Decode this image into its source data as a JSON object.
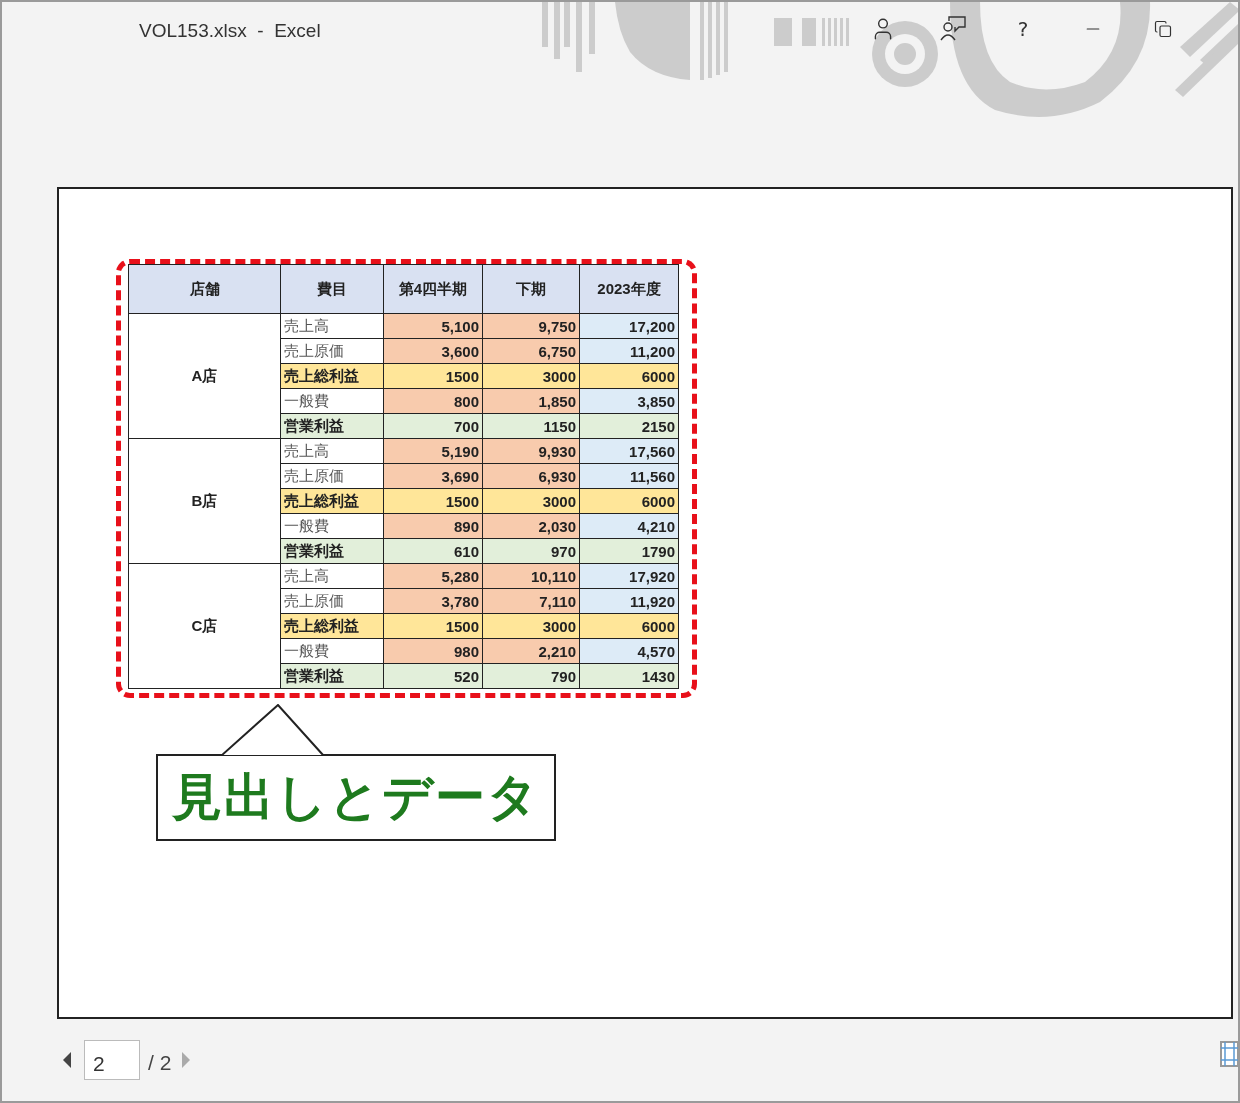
{
  "window": {
    "title": "VOL153.xlsx  -  Excel",
    "help": "?"
  },
  "table": {
    "columns": [
      "店舗",
      "費目",
      "第4四半期",
      "下期",
      "2023年度"
    ],
    "stores": [
      {
        "name": "A店",
        "rows": [
          {
            "kind": "sales",
            "item": "売上高",
            "values": [
              "5,100",
              "9,750",
              "17,200"
            ]
          },
          {
            "kind": "sales",
            "item": "売上原価",
            "values": [
              "3,600",
              "6,750",
              "11,200"
            ]
          },
          {
            "kind": "gross",
            "item": "売上総利益",
            "values": [
              "1500",
              "3000",
              "6000"
            ]
          },
          {
            "kind": "sales",
            "item": "一般費",
            "values": [
              "800",
              "1,850",
              "3,850"
            ]
          },
          {
            "kind": "operating",
            "item": "営業利益",
            "values": [
              "700",
              "1150",
              "2150"
            ]
          }
        ]
      },
      {
        "name": "B店",
        "rows": [
          {
            "kind": "sales",
            "item": "売上高",
            "values": [
              "5,190",
              "9,930",
              "17,560"
            ]
          },
          {
            "kind": "sales",
            "item": "売上原価",
            "values": [
              "3,690",
              "6,930",
              "11,560"
            ]
          },
          {
            "kind": "gross",
            "item": "売上総利益",
            "values": [
              "1500",
              "3000",
              "6000"
            ]
          },
          {
            "kind": "sales",
            "item": "一般費",
            "values": [
              "890",
              "2,030",
              "4,210"
            ]
          },
          {
            "kind": "operating",
            "item": "営業利益",
            "values": [
              "610",
              "970",
              "1790"
            ]
          }
        ]
      },
      {
        "name": "C店",
        "rows": [
          {
            "kind": "sales",
            "item": "売上高",
            "values": [
              "5,280",
              "10,110",
              "17,920"
            ]
          },
          {
            "kind": "sales",
            "item": "売上原価",
            "values": [
              "3,780",
              "7,110",
              "11,920"
            ]
          },
          {
            "kind": "gross",
            "item": "売上総利益",
            "values": [
              "1500",
              "3000",
              "6000"
            ]
          },
          {
            "kind": "sales",
            "item": "一般費",
            "values": [
              "980",
              "2,210",
              "4,570"
            ]
          },
          {
            "kind": "operating",
            "item": "営業利益",
            "values": [
              "520",
              "790",
              "1430"
            ]
          }
        ]
      }
    ]
  },
  "callout": {
    "text": "見出しとデータ"
  },
  "pager": {
    "page": "2",
    "total": "/ 2"
  }
}
